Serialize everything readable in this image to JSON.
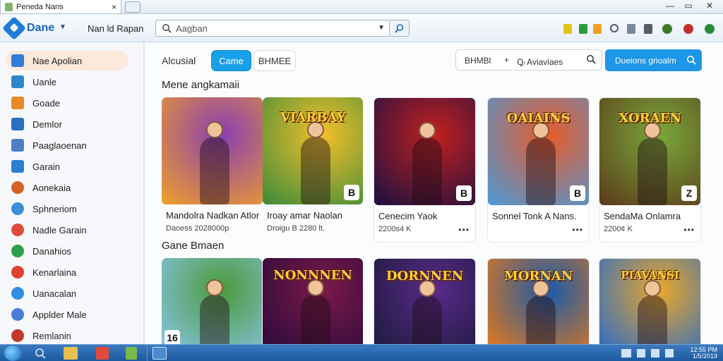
{
  "window": {
    "tab_title": "Ρeneda Nans",
    "minimize": "—",
    "maximize": "▭",
    "close": "✕"
  },
  "toolbar": {
    "brand": "Dane",
    "nav_label": "Nan ld Rapan",
    "search_value": "Aagban",
    "icons": [
      "search-icon",
      "chevron-down-icon",
      "go-search-icon"
    ]
  },
  "sidebar": {
    "items": [
      {
        "label": "Nae Apolian",
        "icon": "home-store-icon",
        "color": "#2f7fd8",
        "active": true
      },
      {
        "label": "Uanle",
        "icon": "window-icon",
        "color": "#2c86c8"
      },
      {
        "label": "Goade",
        "icon": "grid-icon",
        "color": "#e98a2a"
      },
      {
        "label": "Demlor",
        "icon": "user-icon",
        "color": "#2a6fc0"
      },
      {
        "label": "Paaglaoenan",
        "icon": "image-icon",
        "color": "#4f7ec6"
      },
      {
        "label": "Garain",
        "icon": "monitor-icon",
        "color": "#2a7fd0"
      },
      {
        "label": "Aonekaia",
        "icon": "globe-icon",
        "color": "#d8602a"
      },
      {
        "label": "Sphneriom",
        "icon": "chat-icon",
        "color": "#3a8fd8"
      },
      {
        "label": "Nadle Garain",
        "icon": "pinwheel-icon",
        "color": "#e04a3a"
      },
      {
        "label": "Danahios",
        "icon": "leaf-icon",
        "color": "#2f9e4a"
      },
      {
        "label": "Kenarlaina",
        "icon": "pin-icon",
        "color": "#e0402e"
      },
      {
        "label": "Uanacalan",
        "icon": "music-icon",
        "color": "#2f8fe0"
      },
      {
        "label": "Applder Male",
        "icon": "browser-icon",
        "color": "#4a7cd8"
      },
      {
        "label": "Remlanin",
        "icon": "pen-icon",
        "color": "#c0392b"
      }
    ]
  },
  "filters": {
    "label": "Alcusial",
    "tabs": [
      {
        "label": "Came",
        "selected": true
      },
      {
        "label": "BHMEE",
        "selected": false
      }
    ],
    "sort_left": "BHMBl",
    "sort_plus": "+",
    "sort_right": "Ꝙ Aviaviaes",
    "cta": "Dueions grioalm"
  },
  "sections": [
    {
      "title": "Mene angkamaii",
      "cards": [
        {
          "title": "Mandolra Nadkan Atlor",
          "meta": "Daoess  2028000p",
          "badge": "",
          "art_text": "",
          "colors": [
            "#8a3fb0",
            "#f0a02a"
          ]
        },
        {
          "title": "Iroay amar Naolan",
          "meta": "Droigu B  2280 lt.",
          "badge": "B",
          "art_text": "VIARBAY",
          "colors": [
            "#f4c02a",
            "#3a8a3a"
          ]
        },
        {
          "title": "Cenecim Yaok",
          "meta": "2200s4 K",
          "badge": "B",
          "art_text": "",
          "colors": [
            "#c02020",
            "#1a1040"
          ]
        },
        {
          "title": "Sonnel Tonk A Nans.",
          "meta": "",
          "badge": "B",
          "art_text": "OAIAINS",
          "colors": [
            "#e85a2a",
            "#4a9ad8"
          ]
        },
        {
          "title": "SendaMa Onlamra",
          "meta": "2200¢ K",
          "badge": "Z",
          "art_text": "XORAEN",
          "colors": [
            "#7aa83a",
            "#5a3a1a"
          ]
        }
      ]
    },
    {
      "title": "Gane Bmaen",
      "cards": [
        {
          "title": "",
          "meta": "",
          "badge": "16",
          "art_text": "",
          "colors": [
            "#4a9a3a",
            "#8ac4e8"
          ]
        },
        {
          "title": "",
          "meta": "",
          "badge": "",
          "art_text": "NONNNEN",
          "colors": [
            "#7a1a4a",
            "#2a0a3a"
          ]
        },
        {
          "title": "",
          "meta": "",
          "badge": "",
          "art_text": "DORNNEN",
          "colors": [
            "#5a2a8a",
            "#1a1a3a"
          ]
        },
        {
          "title": "",
          "meta": "",
          "badge": "",
          "art_text": "MORNAN",
          "colors": [
            "#1a5aa8",
            "#e87a1a"
          ]
        },
        {
          "title": "",
          "meta": "",
          "badge": "",
          "art_text": "PIAVANSI",
          "colors": [
            "#e8a82a",
            "#2a6ac8"
          ]
        }
      ]
    }
  ],
  "more_label": "•••",
  "taskbar": {
    "clock_time": "12:55 PM",
    "clock_date": "1/5/2019"
  }
}
